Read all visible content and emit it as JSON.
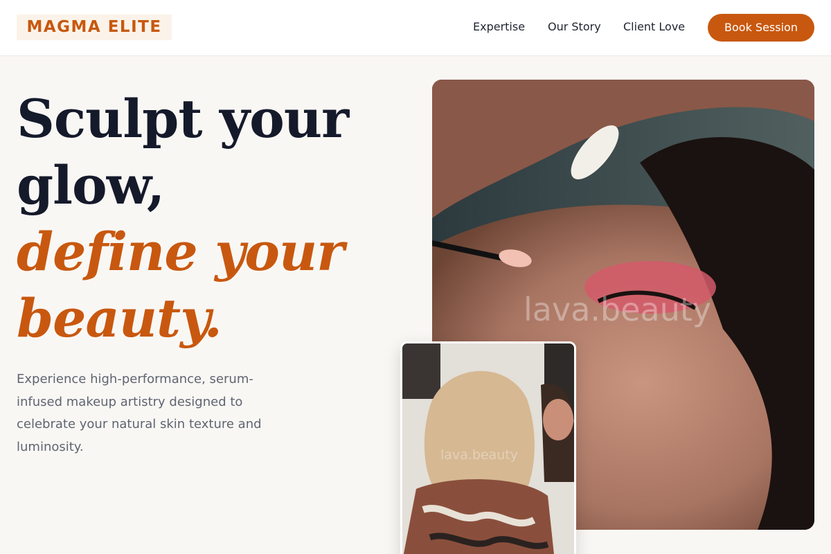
{
  "header": {
    "logo": "MAGMA ELITE",
    "nav": [
      "Expertise",
      "Our Story",
      "Client Love"
    ],
    "cta": "Book Session"
  },
  "hero": {
    "headline_line1": "Sculpt your",
    "headline_line2": "glow,",
    "headline_accent_line1": "define your",
    "headline_accent_line2": "beauty.",
    "subtext": "Experience high-performance, serum-infused makeup artistry designed to celebrate your natural skin texture and luminosity."
  },
  "images": {
    "main_watermark": "lava.beauty",
    "inset_watermark": "lava.beauty"
  },
  "colors": {
    "brand": "#c8580f",
    "heading": "#151a2b",
    "body_text": "#5f6470",
    "background": "#f9f7f4"
  }
}
